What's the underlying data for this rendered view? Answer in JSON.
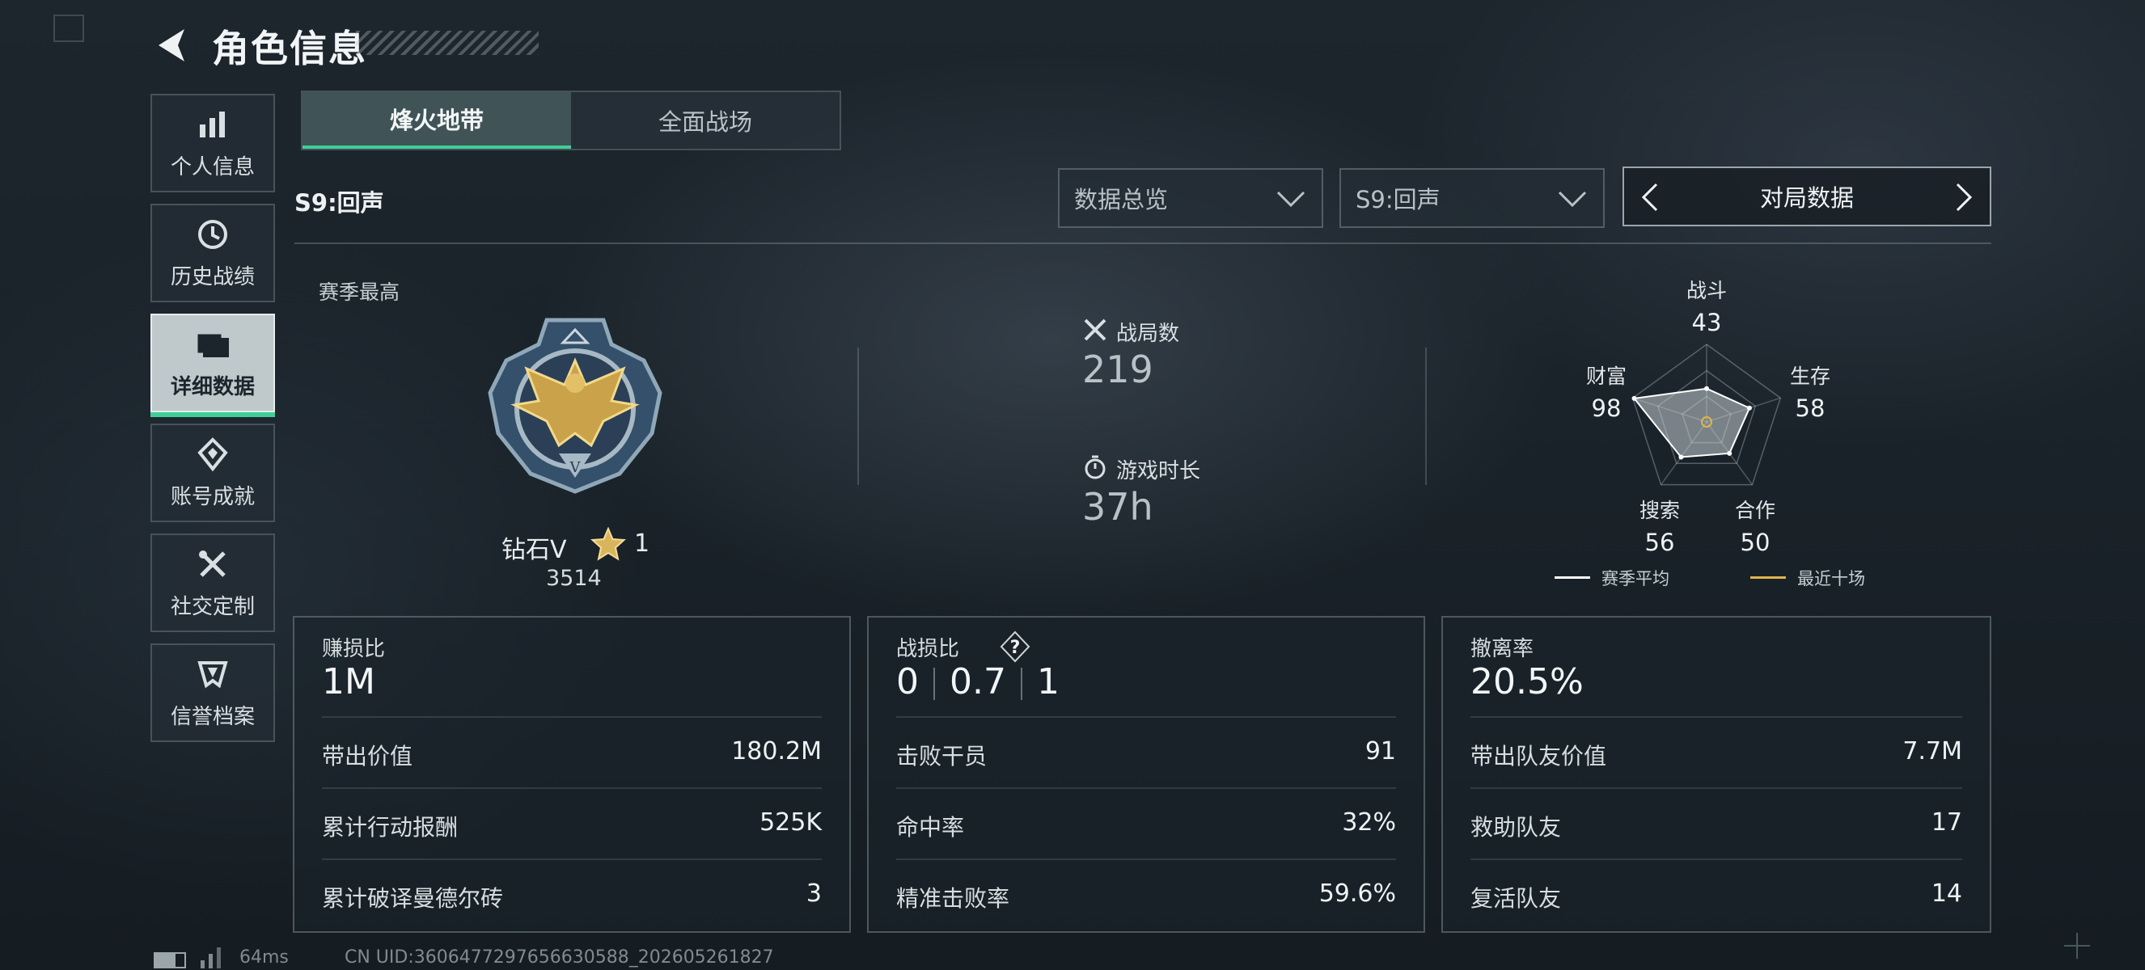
{
  "header": {
    "title": "角色信息"
  },
  "sidebar": {
    "items": [
      {
        "label": "个人信息",
        "icon": "bar-chart-icon"
      },
      {
        "label": "历史战绩",
        "icon": "history-clock-icon"
      },
      {
        "label": "详细数据",
        "icon": "folder-icon",
        "active": true
      },
      {
        "label": "账号成就",
        "icon": "achievement-icon"
      },
      {
        "label": "社交定制",
        "icon": "tools-icon"
      },
      {
        "label": "信誉档案",
        "icon": "shield-icon"
      }
    ]
  },
  "mode_tabs": [
    {
      "label": "烽火地带",
      "active": true
    },
    {
      "label": "全面战场",
      "active": false
    }
  ],
  "season_label": "S9:回声",
  "filters": {
    "overview": "数据总览",
    "season": "S9:回声",
    "pager_label": "对局数据"
  },
  "rank": {
    "section_title": "赛季最高",
    "name": "钻石V",
    "stars": "1",
    "points": "3514"
  },
  "summary": {
    "matches_label": "战局数",
    "matches_value": "219",
    "playtime_label": "游戏时长",
    "playtime_value": "37h"
  },
  "radar": {
    "axes": [
      {
        "label": "战斗",
        "value": "43",
        "score": 43
      },
      {
        "label": "生存",
        "value": "58",
        "score": 58
      },
      {
        "label": "合作",
        "value": "50",
        "score": 50
      },
      {
        "label": "搜索",
        "value": "56",
        "score": 56
      },
      {
        "label": "财富",
        "value": "98",
        "score": 98
      }
    ],
    "legend_avg": "赛季平均",
    "legend_recent": "最近十场",
    "color_avg": "#ffffff",
    "color_recent": "#e0b54a"
  },
  "panels": {
    "profit": {
      "title": "赚损比",
      "big": "1M",
      "rows": [
        {
          "label": "带出价值",
          "value": "180.2M"
        },
        {
          "label": "累计行动报酬",
          "value": "525K"
        },
        {
          "label": "累计破译曼德尔砖",
          "value": "3"
        }
      ]
    },
    "combat": {
      "title": "战损比",
      "ratio": [
        "0",
        "0.7",
        "1"
      ],
      "help": "?",
      "rows": [
        {
          "label": "击败干员",
          "value": "91"
        },
        {
          "label": "命中率",
          "value": "32%"
        },
        {
          "label": "精准击败率",
          "value": "59.6%"
        }
      ]
    },
    "extract": {
      "title": "撤离率",
      "big": "20.5%",
      "rows": [
        {
          "label": "带出队友价值",
          "value": "7.7M"
        },
        {
          "label": "救助队友",
          "value": "17"
        },
        {
          "label": "复活队友",
          "value": "14"
        }
      ]
    }
  },
  "footer": {
    "ping": "64ms",
    "uid": "CN UID:3606477297656630588_202605261827"
  }
}
